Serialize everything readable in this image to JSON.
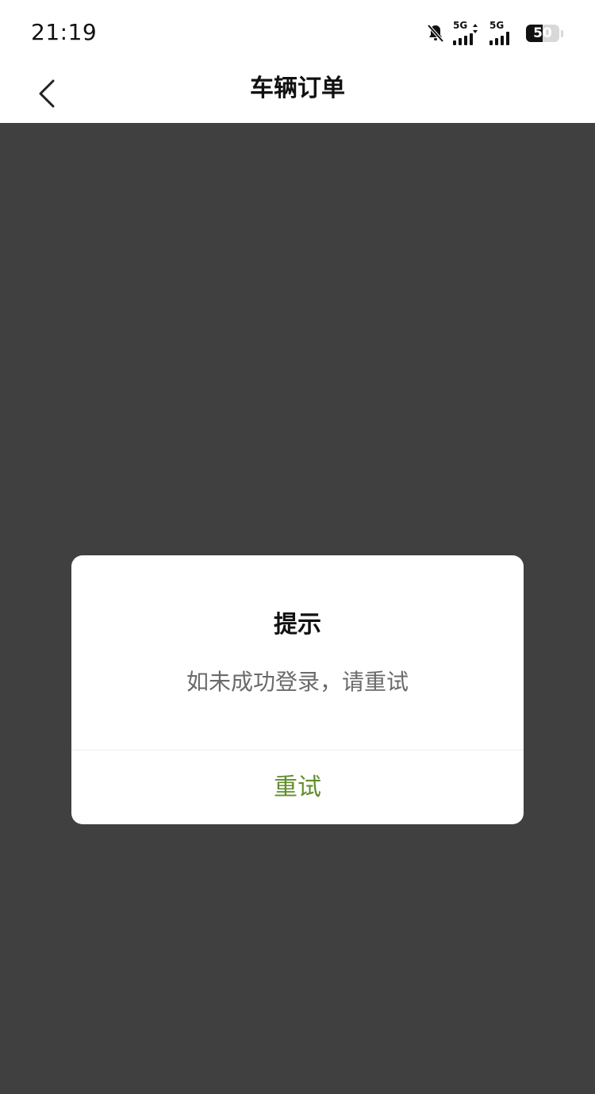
{
  "status_bar": {
    "time": "21:19",
    "network_1": "5G",
    "network_2": "5G",
    "battery_level": "50",
    "icons": [
      "bell-mute-icon",
      "signal-icon",
      "signal-icon",
      "battery-icon"
    ]
  },
  "nav": {
    "title": "车辆订单",
    "back_icon": "chevron-left-icon"
  },
  "dialog": {
    "title": "提示",
    "message": "如未成功登录，请重试",
    "button_label": "重试"
  },
  "colors": {
    "overlay": "#404040",
    "accent": "#5f8d2c",
    "message_text": "#6a6a6a"
  }
}
